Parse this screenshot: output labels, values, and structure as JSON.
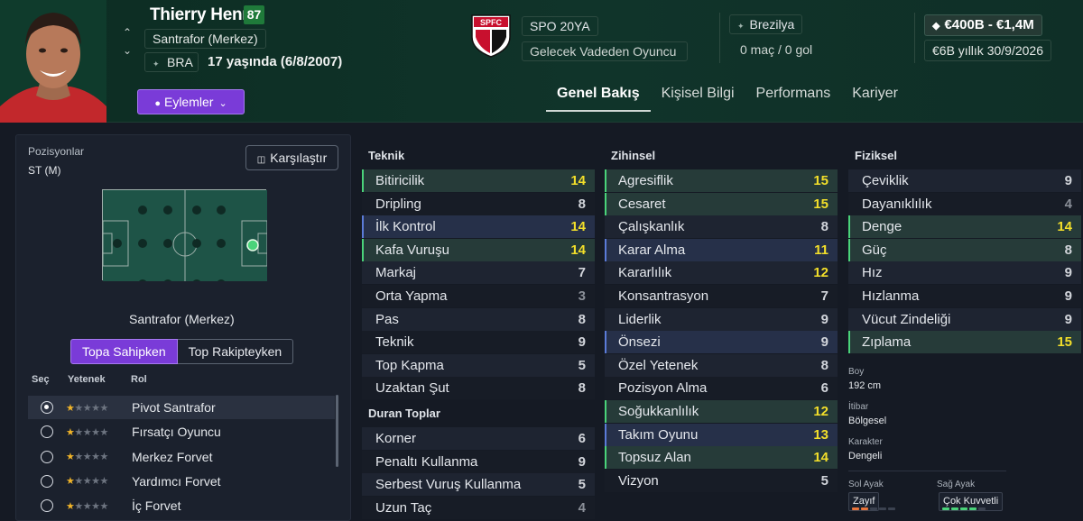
{
  "player": {
    "name": "Thierry Henry",
    "rating": "87",
    "position": "Santrafor (Merkez)",
    "nationality": "BRA",
    "age_line": "17 yaşında (6/8/2007)",
    "actions_label": "Eylemler"
  },
  "club": {
    "squad": "SPO 20YA",
    "status": "Gelecek Vadeden Oyuncu",
    "crest_text": "SPFC",
    "league": "Brezilya",
    "apps": "0 maç / 0 gol",
    "value": "€400B - €1,4M",
    "wage_amount": "€6B yıllık",
    "wage_until": "30/9/2026"
  },
  "tabs": [
    "Genel Bakış",
    "Kişisel Bilgi",
    "Performans",
    "Kariyer"
  ],
  "left": {
    "positions_title": "Pozisyonlar",
    "positions_value": "ST (M)",
    "compare_label": "Karşılaştır",
    "pitch_caption": "Santrafor (Merkez)",
    "toggle_on": "Topa Sahipken",
    "toggle_off": "Top Rakipteyken",
    "headers": {
      "select": "Seç",
      "ability": "Yetenek",
      "role": "Rol"
    },
    "roles": [
      {
        "name": "Pivot Santrafor",
        "stars": 1,
        "selected": true
      },
      {
        "name": "Fırsatçı Oyuncu",
        "stars": 1,
        "selected": false
      },
      {
        "name": "Merkez Forvet",
        "stars": 1,
        "selected": false
      },
      {
        "name": "Yardımcı Forvet",
        "stars": 1,
        "selected": false
      },
      {
        "name": "İç Forvet",
        "stars": 1,
        "selected": false
      }
    ]
  },
  "attributes": {
    "technical_title": "Teknik",
    "technical": [
      {
        "name": "Bitiricilik",
        "value": "14",
        "style": "hl"
      },
      {
        "name": "Dripling",
        "value": "8",
        "style": ""
      },
      {
        "name": "İlk Kontrol",
        "value": "14",
        "style": "key"
      },
      {
        "name": "Kafa Vuruşu",
        "value": "14",
        "style": "hl"
      },
      {
        "name": "Markaj",
        "value": "7",
        "style": ""
      },
      {
        "name": "Orta Yapma",
        "value": "3",
        "style": ""
      },
      {
        "name": "Pas",
        "value": "8",
        "style": ""
      },
      {
        "name": "Teknik",
        "value": "9",
        "style": ""
      },
      {
        "name": "Top Kapma",
        "value": "5",
        "style": ""
      },
      {
        "name": "Uzaktan Şut",
        "value": "8",
        "style": ""
      }
    ],
    "setpieces_title": "Duran Toplar",
    "setpieces": [
      {
        "name": "Korner",
        "value": "6",
        "style": ""
      },
      {
        "name": "Penaltı Kullanma",
        "value": "9",
        "style": ""
      },
      {
        "name": "Serbest Vuruş Kullanma",
        "value": "5",
        "style": ""
      },
      {
        "name": "Uzun Taç",
        "value": "4",
        "style": ""
      }
    ],
    "mental_title": "Zihinsel",
    "mental": [
      {
        "name": "Agresiflik",
        "value": "15",
        "style": "hl"
      },
      {
        "name": "Cesaret",
        "value": "15",
        "style": "hl"
      },
      {
        "name": "Çalışkanlık",
        "value": "8",
        "style": ""
      },
      {
        "name": "Karar Alma",
        "value": "11",
        "style": "key"
      },
      {
        "name": "Kararlılık",
        "value": "12",
        "style": ""
      },
      {
        "name": "Konsantrasyon",
        "value": "7",
        "style": ""
      },
      {
        "name": "Liderlik",
        "value": "9",
        "style": ""
      },
      {
        "name": "Önsezi",
        "value": "9",
        "style": "key"
      },
      {
        "name": "Özel Yetenek",
        "value": "8",
        "style": ""
      },
      {
        "name": "Pozisyon Alma",
        "value": "6",
        "style": ""
      },
      {
        "name": "Soğukkanlılık",
        "value": "12",
        "style": "hl"
      },
      {
        "name": "Takım Oyunu",
        "value": "13",
        "style": "key"
      },
      {
        "name": "Topsuz Alan",
        "value": "14",
        "style": "hl"
      },
      {
        "name": "Vizyon",
        "value": "5",
        "style": ""
      }
    ],
    "physical_title": "Fiziksel",
    "physical": [
      {
        "name": "Çeviklik",
        "value": "9",
        "style": ""
      },
      {
        "name": "Dayanıklılık",
        "value": "4",
        "style": ""
      },
      {
        "name": "Denge",
        "value": "14",
        "style": "hl"
      },
      {
        "name": "Güç",
        "value": "8",
        "style": "hl"
      },
      {
        "name": "Hız",
        "value": "9",
        "style": ""
      },
      {
        "name": "Hızlanma",
        "value": "9",
        "style": ""
      },
      {
        "name": "Vücut Zindeliği",
        "value": "9",
        "style": ""
      },
      {
        "name": "Zıplama",
        "value": "15",
        "style": "hl"
      }
    ]
  },
  "info": {
    "height_label": "Boy",
    "height": "192 cm",
    "reputation_label": "İtibar",
    "reputation": "Bölgesel",
    "character_label": "Karakter",
    "character": "Dengeli",
    "left_foot_label": "Sol Ayak",
    "left_foot": "Zayıf",
    "right_foot_label": "Sağ Ayak",
    "right_foot": "Çok Kuvvetli"
  },
  "colors": {
    "accent": "#7a3bd8",
    "highlight_value": "#f3df2a",
    "pitch": "#1e5447",
    "good": "#4ad37a"
  }
}
